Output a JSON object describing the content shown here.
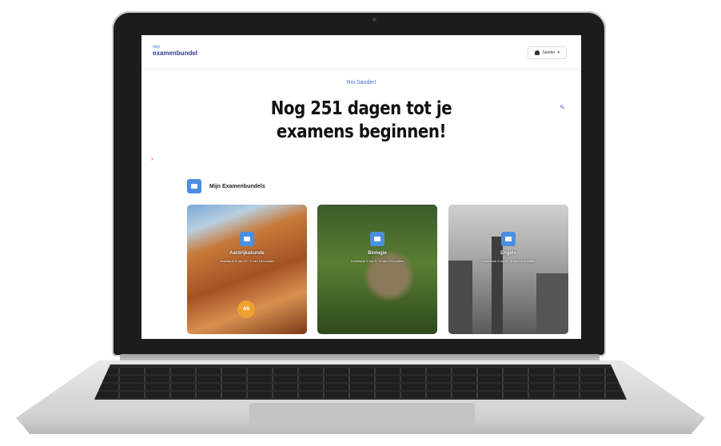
{
  "app": {
    "logo_small": "mijn",
    "logo_main": "examenbundel",
    "user_label": "Sander"
  },
  "hero": {
    "greeting": "Hoi Sander!",
    "headline": "Nog 251 dagen tot je examens beginnen!"
  },
  "section": {
    "title": "Mijn Examenbundels"
  },
  "cards": [
    {
      "title": "Aardrijkskunde",
      "sub": "Hoofdstuk 6 van 19 · 1 van 18 bundels",
      "progress": "4/8"
    },
    {
      "title": "Biologie",
      "sub": "Hoofdstuk 2 van 9 · 0 van 18 bundels",
      "progress": ""
    },
    {
      "title": "Engels",
      "sub": "Hoofdstuk 0 van 8 · 0 van 18 bundels",
      "progress": ""
    }
  ],
  "colors": {
    "accent": "#4a8fe0",
    "progress": "#f0a030"
  }
}
